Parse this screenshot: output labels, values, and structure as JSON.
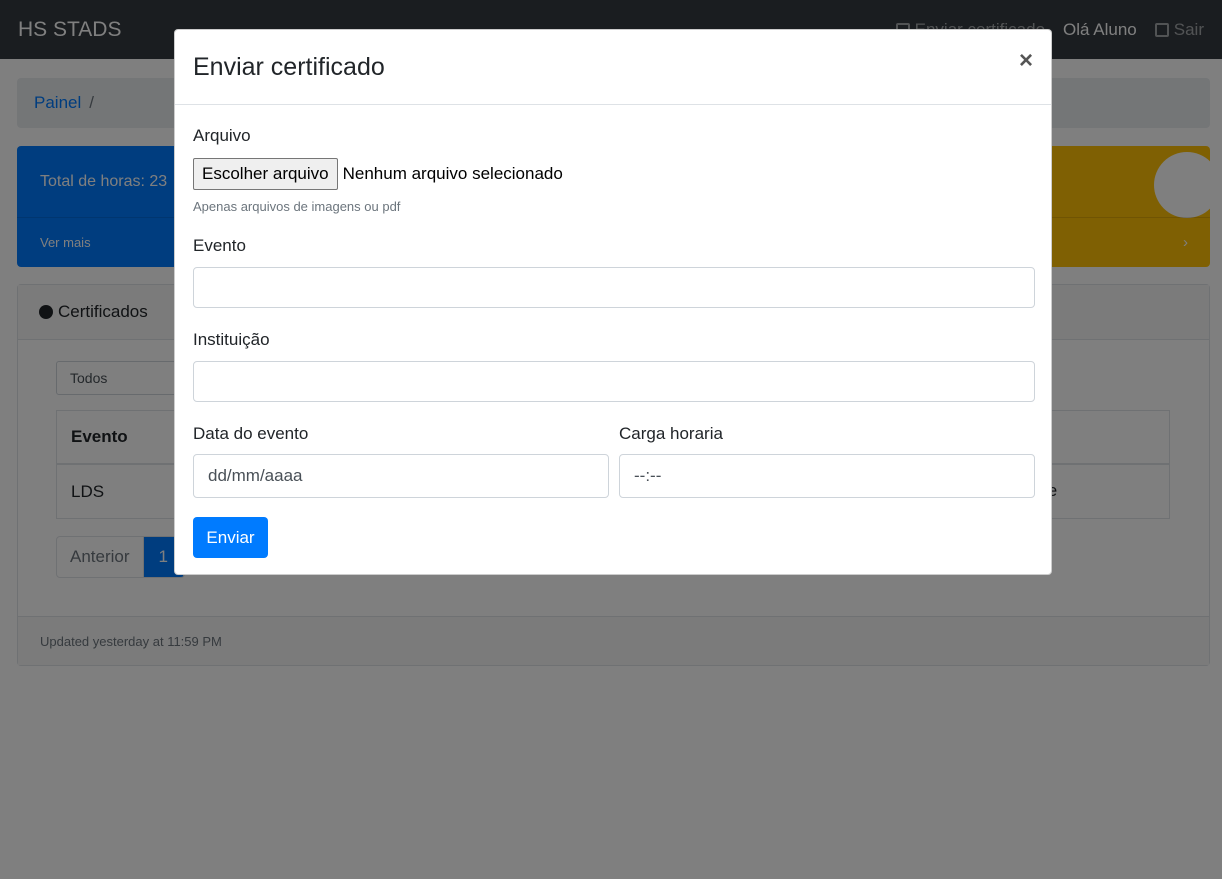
{
  "navbar": {
    "brand": "HS STADS",
    "send_certificate": "Enviar certificado",
    "greeting": "Olá Aluno",
    "logout": "Sair"
  },
  "breadcrumb": {
    "item": "Painel",
    "separator": "/"
  },
  "cards": {
    "total_hours": "Total de horas: 23",
    "see_more": "Ver mais",
    "chevron": "›"
  },
  "certificates": {
    "header": "Certificados",
    "filter_selected": "Todos",
    "columns": [
      "Evento"
    ],
    "rows": [
      {
        "evento": "LDS",
        "status_partial": "te"
      }
    ],
    "pagination": {
      "prev": "Anterior",
      "current": "1"
    },
    "footer": "Updated yesterday at 11:59 PM"
  },
  "modal": {
    "title": "Enviar certificado",
    "close": "×",
    "file_label": "Arquivo",
    "file_button": "Escolher arquivo",
    "file_status": "Nenhum arquivo selecionado",
    "file_help": "Apenas arquivos de imagens ou pdf",
    "event_label": "Evento",
    "event_value": "",
    "institution_label": "Instituição",
    "institution_value": "",
    "date_label": "Data do evento",
    "date_placeholder": "dd/mm/aaaa",
    "hours_label": "Carga horaria",
    "hours_placeholder": "--:--",
    "submit": "Enviar"
  },
  "colors": {
    "primary": "#007bff",
    "warning": "#ffc107",
    "navbar": "#343a40"
  }
}
